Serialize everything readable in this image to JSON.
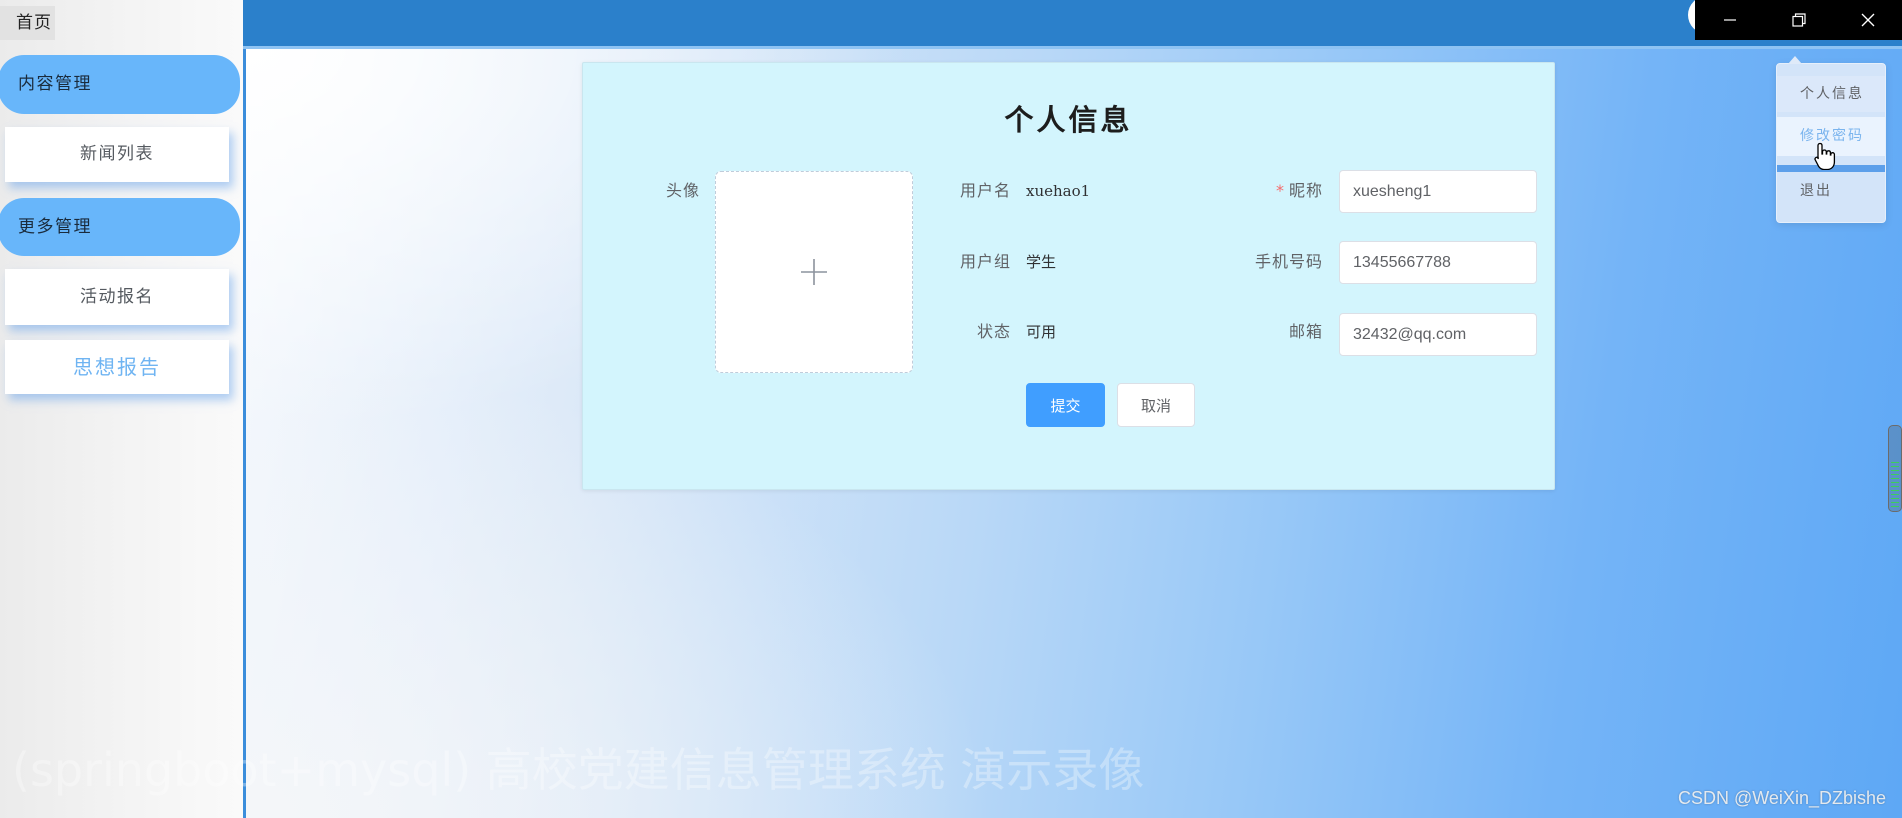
{
  "sidebar": {
    "home_tab": "首页",
    "menus": [
      {
        "title": "内容管理",
        "items": [
          {
            "label": "新闻列表"
          }
        ]
      },
      {
        "title": "更多管理",
        "items": [
          {
            "label": "活动报名"
          },
          {
            "label": "思想报告",
            "highlighted": true
          }
        ]
      }
    ]
  },
  "header": {
    "avatar_icon": "user-avatar-icon",
    "window_controls": [
      "minimize-icon",
      "restore-icon",
      "close-icon"
    ]
  },
  "user_menu": {
    "items": [
      {
        "label": "个人信息"
      },
      {
        "label": "修改密码",
        "hovered": true
      },
      {
        "label": "退出"
      }
    ],
    "cursor_icon": "hand-pointer-icon"
  },
  "profile_form": {
    "title": "个人信息",
    "avatar": {
      "label": "头像",
      "upload_icon": "plus-icon"
    },
    "username": {
      "label": "用户名",
      "value": "xuehao1"
    },
    "user_group": {
      "label": "用户组",
      "value": "学生"
    },
    "status": {
      "label": "状态",
      "value": "可用"
    },
    "nickname": {
      "required_mark": "*",
      "label": "昵称",
      "value": "xuesheng1"
    },
    "phone": {
      "label": "手机号码",
      "value": "13455667788"
    },
    "email": {
      "label": "邮箱",
      "value": "32432@qq.com"
    },
    "submit_label": "提交",
    "cancel_label": "取消"
  },
  "overlay": {
    "watermark": "(springboot+mysql) 高校党建信息管理系统 演示录像",
    "credit": "CSDN @WeiXin_DZbishe"
  },
  "colors": {
    "top_bar": "#2b80cb",
    "sidebar_group": "#68b6fa",
    "card_background": "#d3f5fd",
    "primary_button": "#409eff",
    "required_mark": "#f56c6c",
    "menu_hover_text": "#7ab4ee"
  }
}
